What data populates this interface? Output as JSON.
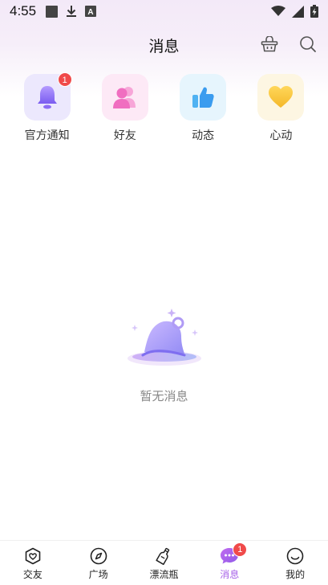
{
  "status_bar": {
    "time": "4:55",
    "icons_left": [
      "stop-square-icon",
      "download-icon",
      "a-badge-icon"
    ],
    "icons_right": [
      "wifi-icon",
      "signal-icon",
      "battery-charging-icon"
    ]
  },
  "header": {
    "title": "消息",
    "actions": [
      "basket-icon",
      "search-icon"
    ]
  },
  "quick_access": [
    {
      "label": "官方通知",
      "icon": "bell-icon",
      "badge": "1",
      "color": "#8e74f0",
      "bg": "#ece8fd"
    },
    {
      "label": "好友",
      "icon": "people-icon",
      "color": "#f07ac4",
      "bg": "#fde9f6"
    },
    {
      "label": "动态",
      "icon": "thumbs-up-icon",
      "color": "#3fa6f0",
      "bg": "#e6f5fd"
    },
    {
      "label": "心动",
      "icon": "heart-icon",
      "color": "#f5c33b",
      "bg": "#fdf6e2"
    }
  ],
  "empty_state": {
    "icon": "bell-illustration",
    "text": "暂无消息"
  },
  "bottom_nav": [
    {
      "label": "交友",
      "icon": "heart-shield-icon"
    },
    {
      "label": "广场",
      "icon": "compass-icon"
    },
    {
      "label": "漂流瓶",
      "icon": "bottle-icon"
    },
    {
      "label": "消息",
      "icon": "chat-bubble-icon",
      "active": true,
      "badge": "1"
    },
    {
      "label": "我的",
      "icon": "smile-icon"
    }
  ],
  "colors": {
    "accent": "#a863e8",
    "badge": "#f04a4a"
  }
}
